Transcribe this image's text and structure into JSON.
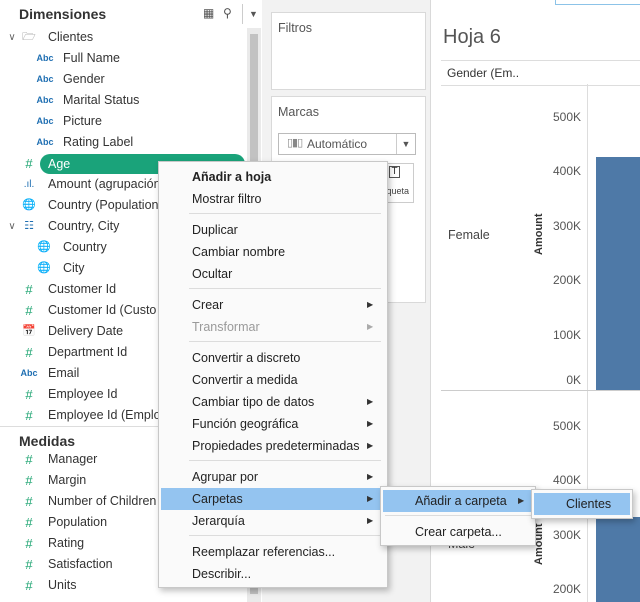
{
  "data_pane": {
    "dimensions_title": "Dimensiones",
    "measures_title": "Medidas",
    "dimensions": [
      {
        "label": "Clientes",
        "icon": "folder"
      },
      {
        "label": "Full Name",
        "icon": "Abc"
      },
      {
        "label": "Gender",
        "icon": "Abc"
      },
      {
        "label": "Marital Status",
        "icon": "Abc"
      },
      {
        "label": "Picture",
        "icon": "Abc"
      },
      {
        "label": "Rating Label",
        "icon": "Abc"
      },
      {
        "label": "Age",
        "icon": "#"
      },
      {
        "label": "Amount (agrupación)",
        "icon": "bins"
      },
      {
        "label": "Country (Population)",
        "icon": "globe"
      },
      {
        "label": "Country, City",
        "icon": "hierarchy"
      },
      {
        "label": "Country",
        "icon": "globe"
      },
      {
        "label": "City",
        "icon": "globe"
      },
      {
        "label": "Customer Id",
        "icon": "#"
      },
      {
        "label": "Customer Id (Custo",
        "icon": "#"
      },
      {
        "label": "Delivery Date",
        "icon": "calendar"
      },
      {
        "label": "Department Id",
        "icon": "#"
      },
      {
        "label": "Email",
        "icon": "Abc"
      },
      {
        "label": "Employee Id",
        "icon": "#"
      },
      {
        "label": "Employee Id (Emplo",
        "icon": "#"
      }
    ],
    "measures": [
      {
        "label": "Manager",
        "icon": "#"
      },
      {
        "label": "Margin",
        "icon": "#"
      },
      {
        "label": "Number of Children",
        "icon": "#"
      },
      {
        "label": "Population",
        "icon": "#"
      },
      {
        "label": "Rating",
        "icon": "#"
      },
      {
        "label": "Satisfaction",
        "icon": "#"
      },
      {
        "label": "Units",
        "icon": "#"
      }
    ]
  },
  "filters": {
    "title": "Filtros"
  },
  "marks": {
    "title": "Marcas",
    "type": "Automático",
    "label_button": "Etiqueta"
  },
  "view": {
    "sheet_title": "Hoja 6",
    "column_header": "Gender (Em..",
    "row_labels": [
      "Female",
      "Male"
    ],
    "axis_title": "Amount",
    "ticks_top": [
      "500K",
      "400K",
      "300K",
      "200K",
      "100K",
      "0K"
    ],
    "ticks_bottom": [
      "500K",
      "400K",
      "300K",
      "200K"
    ],
    "bar_color": "#4e79a7"
  },
  "context_menu": {
    "items": [
      {
        "label": "Añadir a hoja",
        "bold": true
      },
      {
        "label": "Mostrar filtro"
      },
      {
        "sep": true
      },
      {
        "label": "Duplicar"
      },
      {
        "label": "Cambiar nombre"
      },
      {
        "label": "Ocultar"
      },
      {
        "sep": true
      },
      {
        "label": "Crear",
        "submenu": true
      },
      {
        "label": "Transformar",
        "submenu": true,
        "disabled": true
      },
      {
        "sep": true
      },
      {
        "label": "Convertir a discreto"
      },
      {
        "label": "Convertir a medida"
      },
      {
        "label": "Cambiar tipo de datos",
        "submenu": true
      },
      {
        "label": "Función geográfica",
        "submenu": true
      },
      {
        "label": "Propiedades predeterminadas",
        "submenu": true
      },
      {
        "sep": true
      },
      {
        "label": "Agrupar por",
        "submenu": true
      },
      {
        "label": "Carpetas",
        "submenu": true,
        "highlighted": true
      },
      {
        "label": "Jerarquía",
        "submenu": true
      },
      {
        "sep": true
      },
      {
        "label": "Reemplazar referencias..."
      },
      {
        "label": "Describir..."
      }
    ]
  },
  "submenu_carpetas": {
    "items": [
      {
        "label": "Añadir a carpeta",
        "submenu": true,
        "highlighted": true
      },
      {
        "sep": true
      },
      {
        "label": "Crear carpeta..."
      }
    ]
  },
  "submenu_add_folder": {
    "items": [
      {
        "label": "Clientes",
        "highlighted": true
      }
    ]
  }
}
